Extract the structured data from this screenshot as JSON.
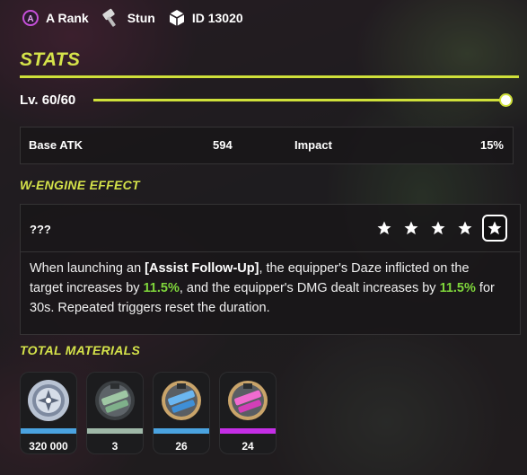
{
  "header": {
    "rank": "A Rank",
    "attribute": "Stun",
    "id": "ID 13020"
  },
  "stats": {
    "title": "STATS",
    "level": "Lv. 60/60",
    "level_progress": 1.0,
    "base_atk_label": "Base ATK",
    "base_atk_value": "594",
    "secondary_label": "Impact",
    "secondary_value": "15%"
  },
  "wengine": {
    "title": "W-ENGINE EFFECT",
    "name": "???",
    "refinement_levels": 5,
    "selected_refinement": 5,
    "description": {
      "p1": "When launching an ",
      "keyword": "[Assist Follow-Up]",
      "p2": ", the equipper's Daze inflicted on the target increases by ",
      "v1": "11.5%",
      "p3": ", and the equipper's DMG dealt increases by ",
      "v2": "11.5%",
      "p4": " for 30s. Repeated triggers reset the duration."
    }
  },
  "materials": {
    "title": "TOTAL MATERIALS",
    "items": [
      {
        "icon": "denny-coin-icon",
        "qty": "320 000",
        "band_color": "#4aa3e0"
      },
      {
        "icon": "green-component-icon",
        "qty": "3",
        "band_color": "#9fb8a8"
      },
      {
        "icon": "blue-component-icon",
        "qty": "26",
        "band_color": "#4aa3e0"
      },
      {
        "icon": "purple-component-icon",
        "qty": "24",
        "band_color": "#c42ee6"
      }
    ]
  },
  "colors": {
    "accent": "#d5e34a",
    "highlight": "#7ed53b"
  }
}
